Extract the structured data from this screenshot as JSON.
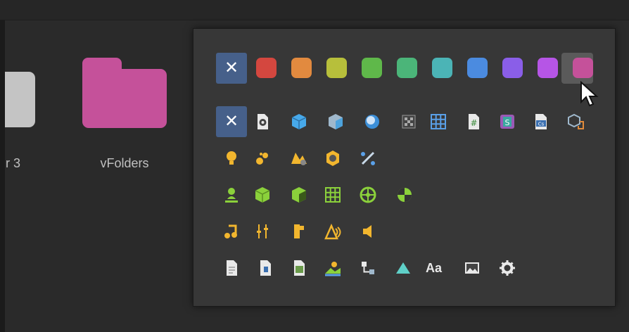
{
  "folders": [
    {
      "label": "r 3"
    },
    {
      "label": "vFolders"
    }
  ],
  "colors": {
    "selection": "#46608a",
    "swatches": [
      "#d4473f",
      "#e28a3f",
      "#b7bf3b",
      "#5fb84a",
      "#4bb579",
      "#4bb4b6",
      "#4b8be0",
      "#8a5ee8",
      "#b655e6",
      "#c5519a"
    ]
  },
  "icons": {
    "row1": [
      "none-icon",
      "scene-file-icon",
      "prefab-cube-icon",
      "model-prefab-icon",
      "material-sphere-icon",
      "mesh-checker-icon",
      "grid-icon",
      "script-hash-icon",
      "shader-icon",
      "csharp-file-icon",
      "package-icon"
    ],
    "row2": [
      "light-bulb-icon",
      "particles-icon",
      "terrain-icon",
      "hexagon-nut-icon",
      "joint-icon"
    ],
    "row3": [
      "player-character-icon",
      "cube-green-icon",
      "cube-dark-icon",
      "navmesh-grid-icon",
      "wheel-icon",
      "pie-icon"
    ],
    "row4": [
      "music-note-icon",
      "audio-mixer-icon",
      "audio-source-icon",
      "audio-reverb-icon",
      "speaker-icon"
    ],
    "row5": [
      "document-icon",
      "text-file-icon",
      "image-file-icon",
      "landscape-icon",
      "hierarchy-icon",
      "sprite-icon",
      "font-aa-icon",
      "picture-icon",
      "gear-icon"
    ]
  },
  "font_text": "Aa"
}
